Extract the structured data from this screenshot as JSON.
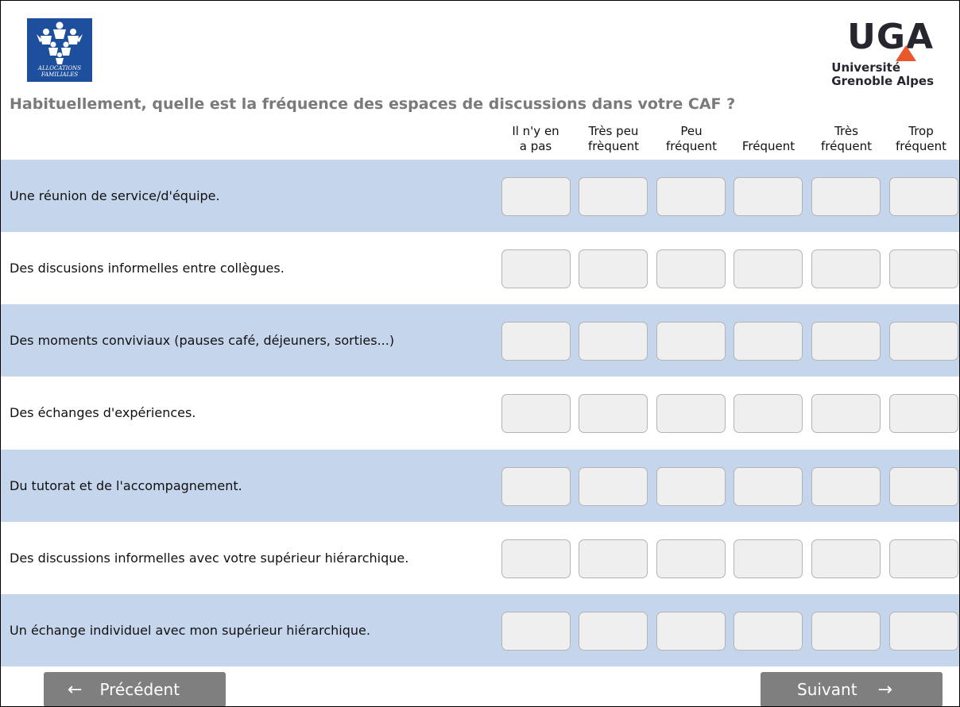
{
  "logos": {
    "caf_caption": "ALLOCATIONS FAMILIALES",
    "uga_mark": "UGA",
    "uga_name_line1": "Université",
    "uga_name_line2": "Grenoble Alpes"
  },
  "question": {
    "title": "Habituellement, quelle est la fréquence des espaces de discussions dans votre CAF ?"
  },
  "columns": [
    {
      "line1": "Il n'y en",
      "line2": "a pas"
    },
    {
      "line1": "Très peu",
      "line2": "frèquent"
    },
    {
      "line1": "Peu",
      "line2": "fréquent"
    },
    {
      "line1": "",
      "line2": "Fréquent"
    },
    {
      "line1": "Très",
      "line2": "fréquent"
    },
    {
      "line1": "Trop",
      "line2": "fréquent"
    }
  ],
  "rows": [
    {
      "label": "Une réunion de service/d'équipe."
    },
    {
      "label": "Des discusions informelles entre collègues."
    },
    {
      "label": "Des moments conviviaux (pauses café, déjeuners, sorties...)"
    },
    {
      "label": "Des échanges d'expériences."
    },
    {
      "label": "Du tutorat et de l'accompagnement."
    },
    {
      "label": "Des discussions informelles avec votre supérieur hiérarchique."
    },
    {
      "label": "Un échange individuel avec mon supérieur hiérarchique."
    }
  ],
  "nav": {
    "prev_label": "Précédent",
    "next_label": "Suivant",
    "prev_icon": "arrow-left-icon",
    "next_icon": "arrow-right-icon"
  },
  "colors": {
    "row_shade": "#c4d5ec",
    "title_grey": "#7a7a7a",
    "button_grey": "#7f7f7f",
    "caf_blue": "#1d4f9c",
    "uga_orange": "#e8582a"
  }
}
